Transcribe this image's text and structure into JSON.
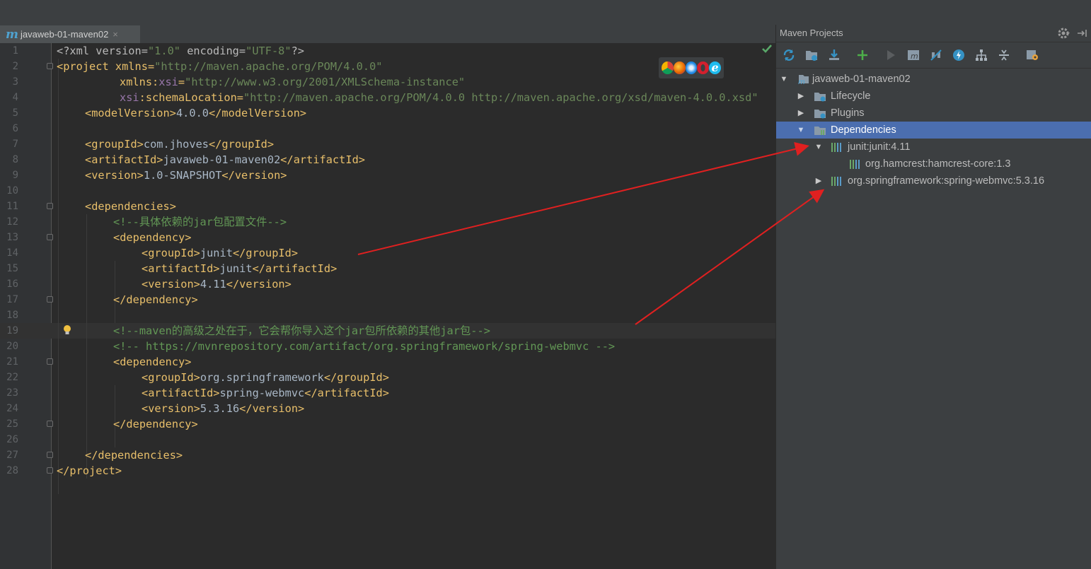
{
  "editor": {
    "tab": {
      "icon": "m",
      "title": "javaweb-01-maven02",
      "close": "×"
    },
    "lines": [
      "1",
      "2",
      "3",
      "4",
      "5",
      "6",
      "7",
      "8",
      "9",
      "10",
      "11",
      "12",
      "13",
      "14",
      "15",
      "16",
      "17",
      "18",
      "19",
      "20",
      "21",
      "22",
      "23",
      "24",
      "25",
      "26",
      "27",
      "28"
    ],
    "code": {
      "l1": [
        "<?xml version=",
        "\"1.0\"",
        " encoding=",
        "\"UTF-8\"",
        "?>"
      ],
      "l2": [
        "<project ",
        "xmlns",
        "=",
        "\"http://maven.apache.org/POM/4.0.0\""
      ],
      "l3": [
        "xmlns:",
        "xsi",
        "=",
        "\"http://www.w3.org/2001/XMLSchema-instance\""
      ],
      "l4": [
        "xsi",
        ":schemaLocation=",
        "\"http://maven.apache.org/POM/4.0.0 http://maven.apache.org/xsd/maven-4.0.0.xsd\""
      ],
      "l5": [
        "<modelVersion>",
        "4.0.0",
        "</modelVersion>"
      ],
      "l7": [
        "<groupId>",
        "com.jhoves",
        "</groupId>"
      ],
      "l8": [
        "<artifactId>",
        "javaweb-01-maven02",
        "</artifactId>"
      ],
      "l9": [
        "<version>",
        "1.0-SNAPSHOT",
        "</version>"
      ],
      "l11": [
        "<dependencies>"
      ],
      "l12": [
        "<!--具体依赖的jar包配置文件-->"
      ],
      "l13": [
        "<dependency>"
      ],
      "l14": [
        "<groupId>",
        "junit",
        "</groupId>"
      ],
      "l15": [
        "<artifactId>",
        "junit",
        "</artifactId>"
      ],
      "l16": [
        "<version>",
        "4.11",
        "</version>"
      ],
      "l17": [
        "</dependency>"
      ],
      "l19": [
        "<!--maven的高级之处在于，它会帮你导入这个jar包所依赖的其他jar包-->"
      ],
      "l20": [
        "<!-- https://mvnrepository.com/artifact/org.springframework/spring-webmvc -->"
      ],
      "l21": [
        "<dependency>"
      ],
      "l22": [
        "<groupId>",
        "org.springframework",
        "</groupId>"
      ],
      "l23": [
        "<artifactId>",
        "spring-webmvc",
        "</artifactId>"
      ],
      "l24": [
        "<version>",
        "5.3.16",
        "</version>"
      ],
      "l25": [
        "</dependency>"
      ],
      "l27": [
        "</dependencies>"
      ],
      "l28": [
        "</project>"
      ]
    },
    "browser_icons": [
      "chrome-icon",
      "firefox-icon",
      "safari-icon",
      "opera-icon",
      "ie-icon"
    ]
  },
  "maven": {
    "title": "Maven Projects",
    "toolbar_icons": [
      "reimport-icon",
      "generate-sources-icon",
      "download-icon",
      "add-icon",
      "run-icon",
      "execute-goal-icon",
      "toggle-offline-icon",
      "skip-tests-icon",
      "show-dependencies-icon",
      "collapse-all-icon",
      "settings-icon"
    ],
    "tree": {
      "root": "javaweb-01-maven02",
      "lifecycle": "Lifecycle",
      "plugins": "Plugins",
      "dependencies": "Dependencies",
      "dep1": "junit:junit:4.11",
      "dep1_child": "org.hamcrest:hamcrest-core:1.3",
      "dep2": "org.springframework:spring-webmvc:5.3.16"
    }
  },
  "colors": {
    "background": "#2b2b2b",
    "panel": "#3c3f41",
    "selection": "#4b6eaf",
    "tag": "#e8bf6a",
    "string": "#6a8759",
    "comment": "#629755",
    "annotation_arrow": "#e02020"
  }
}
